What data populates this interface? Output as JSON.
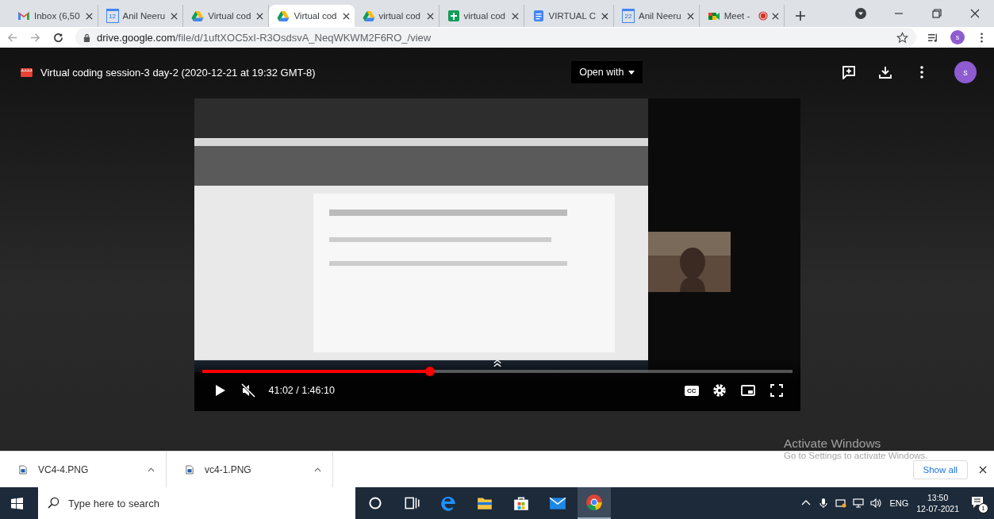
{
  "tabs": [
    {
      "kind": "gmail",
      "title": "Inbox (6,50",
      "selected": false
    },
    {
      "kind": "calendar",
      "icon_text": "12",
      "title": "Anil Neeru",
      "selected": false
    },
    {
      "kind": "drive",
      "title": "Virtual cod",
      "selected": false
    },
    {
      "kind": "drive",
      "title": "Virtual cod",
      "selected": true
    },
    {
      "kind": "drive",
      "title": "virtual cod",
      "selected": false
    },
    {
      "kind": "sheets",
      "title": "virtual cod",
      "selected": false
    },
    {
      "kind": "docs",
      "title": "VIRTUAL C",
      "selected": false
    },
    {
      "kind": "calendar",
      "icon_text": "22",
      "title": "Anil Neeru",
      "selected": false
    },
    {
      "kind": "meet",
      "title": "Meet -",
      "selected": false,
      "recording": true
    }
  ],
  "address": {
    "host": "drive.google.com",
    "path": "/file/d/1uftXOC5xI-R3OsdsvA_NeqWKWM2F6RO_/view"
  },
  "profile": "s",
  "viewer": {
    "title": "Virtual coding session-3 day-2 (2020-12-21 at 19:32 GMT-8)",
    "open_with": "Open with",
    "avatar": "s"
  },
  "player": {
    "progress": {
      "level": 0.386
    },
    "muted": true,
    "time": "41:02 / 1:46:10",
    "cc_label": "CC"
  },
  "downloads": [
    {
      "name": "VC4-4.PNG"
    },
    {
      "name": "vc4-1.PNG"
    }
  ],
  "show_all": "Show all",
  "activation": {
    "title": "Activate Windows",
    "hint": "Go to Settings to activate Windows."
  },
  "taskbar": {
    "search_placeholder": "Type here to search",
    "apps": [
      {
        "kind": "cortana",
        "active": false
      },
      {
        "kind": "taskview",
        "active": false
      },
      {
        "kind": "edge",
        "active": false
      },
      {
        "kind": "explorer",
        "active": false
      },
      {
        "kind": "store",
        "active": false
      },
      {
        "kind": "mail",
        "active": false
      },
      {
        "kind": "chrome",
        "active": true
      }
    ],
    "language": "ENG",
    "time": "13:50",
    "date": "12-07-2021",
    "notifications": "1"
  }
}
